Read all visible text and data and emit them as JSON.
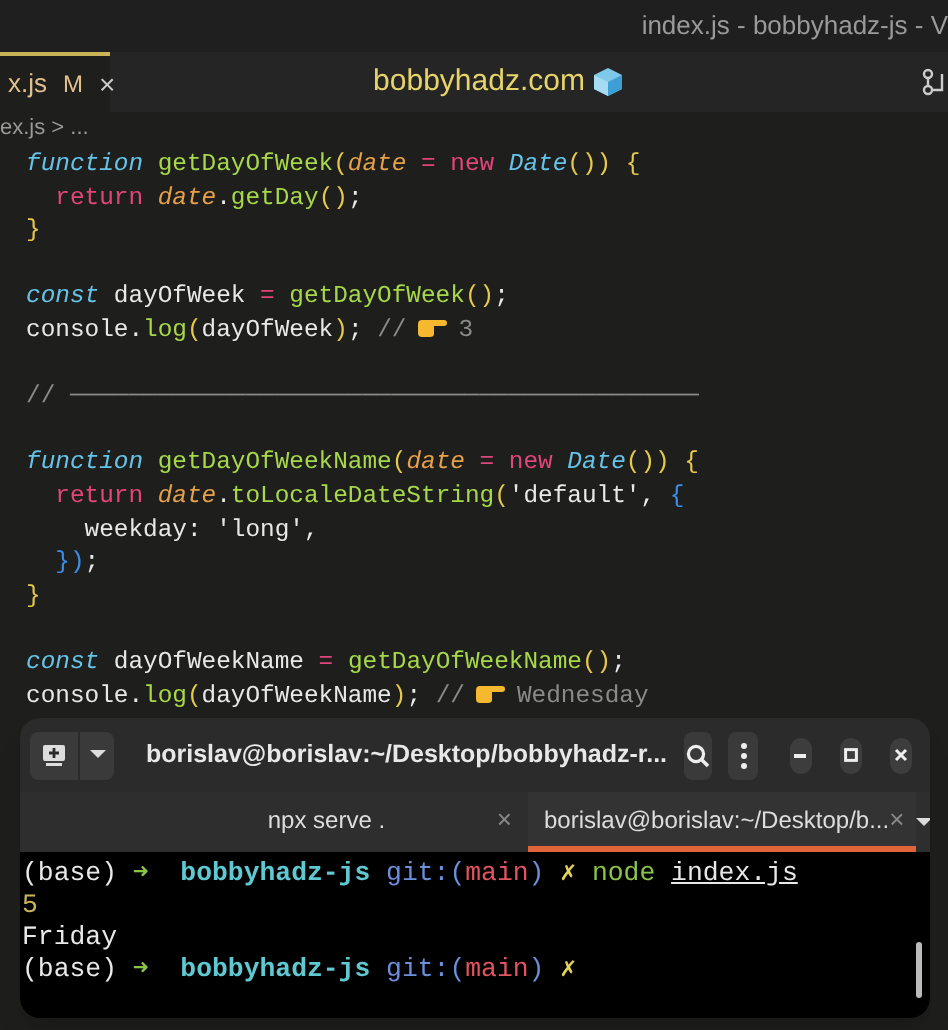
{
  "window": {
    "title": "index.js - bobbyhadz-js - V"
  },
  "tab": {
    "label": "x.js",
    "badge": "M",
    "close": "×",
    "selected": true
  },
  "brand": {
    "label": "bobbyhadz.com"
  },
  "breadcrumb": "ex.js > ...",
  "code": [
    {
      "kind": "code",
      "tokens": [
        {
          "kind": "keyword",
          "text": "function"
        },
        {
          "kind": "function",
          "text": " getDayOfWeek"
        },
        {
          "kind": "punct",
          "text": "("
        },
        {
          "kind": "param",
          "text": "date"
        },
        {
          "kind": "operator",
          "text": " = new"
        },
        {
          "kind": "class",
          "text": " Date"
        },
        {
          "kind": "punct",
          "text": "()) {"
        }
      ]
    },
    {
      "kind": "code",
      "tokens": [
        {
          "kind": "operator",
          "text": "  return"
        },
        {
          "kind": "param",
          "text": " date"
        },
        {
          "kind": "plain",
          "text": "."
        },
        {
          "kind": "function",
          "text": "getDay"
        },
        {
          "kind": "punct",
          "text": "()"
        },
        {
          "kind": "plain",
          "text": ";"
        }
      ]
    },
    {
      "kind": "code",
      "tokens": [
        {
          "kind": "punct",
          "text": "}"
        }
      ]
    },
    {
      "kind": "blank"
    },
    {
      "kind": "code",
      "tokens": [
        {
          "kind": "keyword",
          "text": "const"
        },
        {
          "kind": "plain",
          "text": " dayOfWeek"
        },
        {
          "kind": "operator",
          "text": " ="
        },
        {
          "kind": "function",
          "text": " getDayOfWeek"
        },
        {
          "kind": "punct",
          "text": "()"
        },
        {
          "kind": "plain",
          "text": ";"
        }
      ]
    },
    {
      "kind": "code",
      "tokens": [
        {
          "kind": "plain",
          "text": "console."
        },
        {
          "kind": "function",
          "text": "log"
        },
        {
          "kind": "punct",
          "text": "("
        },
        {
          "kind": "plain",
          "text": "dayOfWeek"
        },
        {
          "kind": "punct",
          "text": ")"
        },
        {
          "kind": "plain",
          "text": ";"
        },
        {
          "kind": "comment",
          "text": " //"
        },
        {
          "kind": "hand"
        },
        {
          "kind": "comment",
          "text": "3"
        }
      ]
    },
    {
      "kind": "blank"
    },
    {
      "kind": "code",
      "tokens": [
        {
          "kind": "comment",
          "text": "// ───────────────────────────────────────────"
        }
      ]
    },
    {
      "kind": "blank"
    },
    {
      "kind": "code",
      "tokens": [
        {
          "kind": "keyword",
          "text": "function"
        },
        {
          "kind": "function",
          "text": " getDayOfWeekName"
        },
        {
          "kind": "punct",
          "text": "("
        },
        {
          "kind": "param",
          "text": "date"
        },
        {
          "kind": "operator",
          "text": " = new"
        },
        {
          "kind": "class",
          "text": " Date"
        },
        {
          "kind": "punct",
          "text": "()) {"
        }
      ]
    },
    {
      "kind": "code",
      "tokens": [
        {
          "kind": "operator",
          "text": "  return"
        },
        {
          "kind": "param",
          "text": " date"
        },
        {
          "kind": "plain",
          "text": "."
        },
        {
          "kind": "function",
          "text": "toLocaleDateString"
        },
        {
          "kind": "punct",
          "text": "("
        },
        {
          "kind": "string",
          "text": "'default'"
        },
        {
          "kind": "plain",
          "text": ","
        },
        {
          "kind": "bracket",
          "text": " {"
        }
      ]
    },
    {
      "kind": "code",
      "tokens": [
        {
          "kind": "plain",
          "text": "    weekday:"
        },
        {
          "kind": "string",
          "text": " 'long'"
        },
        {
          "kind": "plain",
          "text": ","
        }
      ]
    },
    {
      "kind": "code",
      "tokens": [
        {
          "kind": "bracket",
          "text": "  })"
        },
        {
          "kind": "plain",
          "text": ";"
        }
      ]
    },
    {
      "kind": "code",
      "tokens": [
        {
          "kind": "punct",
          "text": "}"
        }
      ]
    },
    {
      "kind": "blank"
    },
    {
      "kind": "code",
      "tokens": [
        {
          "kind": "keyword",
          "text": "const"
        },
        {
          "kind": "plain",
          "text": " dayOfWeekName"
        },
        {
          "kind": "operator",
          "text": " ="
        },
        {
          "kind": "function",
          "text": " getDayOfWeekName"
        },
        {
          "kind": "punct",
          "text": "()"
        },
        {
          "kind": "plain",
          "text": ";"
        }
      ]
    },
    {
      "kind": "code",
      "tokens": [
        {
          "kind": "plain",
          "text": "console."
        },
        {
          "kind": "function",
          "text": "log"
        },
        {
          "kind": "punct",
          "text": "("
        },
        {
          "kind": "plain",
          "text": "dayOfWeekName"
        },
        {
          "kind": "punct",
          "text": ")"
        },
        {
          "kind": "plain",
          "text": ";"
        },
        {
          "kind": "comment",
          "text": " //"
        },
        {
          "kind": "hand"
        },
        {
          "kind": "comment",
          "text": "Wednesday"
        }
      ]
    }
  ],
  "terminal": {
    "title": "borislav@borislav:~/Desktop/bobbyhadz-r...",
    "tabs": [
      {
        "label": "npx serve .",
        "close": "×",
        "selected": false
      },
      {
        "label": "borislav@borislav:~/Desktop/b...",
        "close": "×",
        "selected": true
      }
    ],
    "lines": [
      {
        "tokens": [
          {
            "kind": "plain",
            "text": "(base)"
          },
          {
            "kind": "arrow",
            "text": " ➜"
          },
          {
            "kind": "folder",
            "text": "  bobbyhadz-js"
          },
          {
            "kind": "git",
            "text": " git:("
          },
          {
            "kind": "branch",
            "text": "main"
          },
          {
            "kind": "git",
            "text": ")"
          },
          {
            "kind": "dirty",
            "text": " ✗"
          },
          {
            "kind": "command",
            "text": " node "
          },
          {
            "kind": "file",
            "text": "index.js"
          }
        ]
      },
      {
        "tokens": [
          {
            "kind": "number",
            "text": "5"
          }
        ]
      },
      {
        "tokens": [
          {
            "kind": "plain",
            "text": "Friday"
          }
        ]
      },
      {
        "tokens": [
          {
            "kind": "plain",
            "text": "(base)"
          },
          {
            "kind": "arrow",
            "text": " ➜"
          },
          {
            "kind": "folder",
            "text": "  bobbyhadz-js"
          },
          {
            "kind": "git",
            "text": " git:("
          },
          {
            "kind": "branch",
            "text": "main"
          },
          {
            "kind": "git",
            "text": ")"
          },
          {
            "kind": "dirty",
            "text": " ✗"
          }
        ]
      }
    ]
  }
}
